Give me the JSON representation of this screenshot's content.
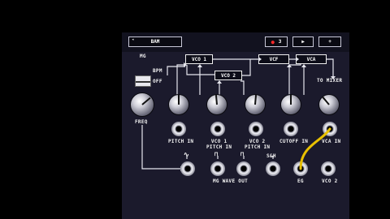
{
  "header": {
    "preset": "BAM",
    "record_value": "3",
    "play_symbol": "▶",
    "add_symbol": "+",
    "accent": "#ff2a2a"
  },
  "mg": {
    "title": "MG",
    "switch_top": "BPM",
    "switch_bottom": "OFF",
    "knob_label": "FREQ"
  },
  "modules": {
    "vco1": "VCO 1",
    "vco2": "VCO 2",
    "vcf": "VCF",
    "vca": "VCA",
    "to_mixer": "TO MIXER"
  },
  "inputs": {
    "pitch_in": "PITCH IN",
    "vco1_pitch": "VCO 1\nPITCH IN",
    "vco2_pitch": "VCO 2\nPITCH IN",
    "cutoff_in": "CUTOFF IN",
    "vca_in": "VCA IN"
  },
  "bottom": {
    "shapes": [
      "∿",
      "⊓",
      "⊓"
    ],
    "sh": "S&H",
    "mg_wave_out": "MG WAVE OUT",
    "eg": "EG",
    "vco2": "VCO 2"
  },
  "colors": {
    "cable": "#e8c000",
    "panel": "#1b1a2c"
  }
}
